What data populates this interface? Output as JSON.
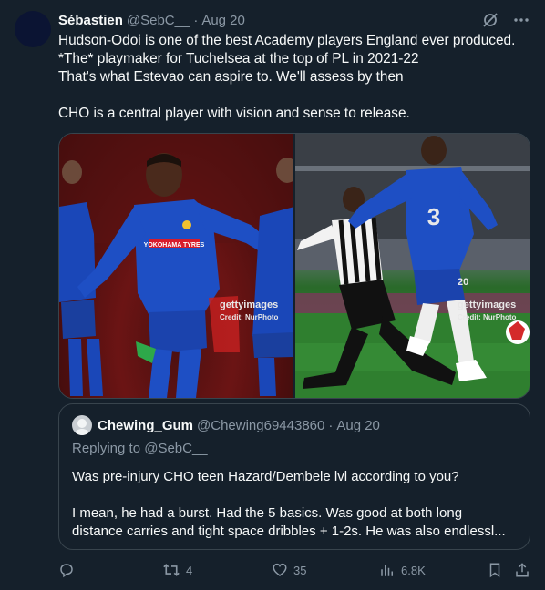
{
  "tweet": {
    "author_name": "Sébastien",
    "author_handle": "@SebC__",
    "separator": "·",
    "date": "Aug 20",
    "lines": [
      "Hudson-Odoi is one of the best Academy players England ever produced.",
      "*The* playmaker for Tuchelsea at the top of PL in 2021-22",
      "That's what Estevao can aspire to. We'll assess by then",
      "",
      "CHO is a central player with vision and sense to release."
    ]
  },
  "media": {
    "watermark_left": "gettyimages",
    "credit_left": "Credit: NurPhoto",
    "watermark_right": "gettyimages",
    "credit_right": "Credit: NurPhoto",
    "shirt_sponsor": "YOKOHAMA TYRES",
    "shirt_number": "3",
    "sleeve_number": "20"
  },
  "quote": {
    "author_name": "Chewing_Gum",
    "author_handle": "@Chewing69443860",
    "separator": "·",
    "date": "Aug 20",
    "replying_to": "Replying to @SebC__",
    "lines": [
      "Was pre-injury CHO teen Hazard/Dembele lvl according to you?",
      "",
      "I mean, he had a burst. Had the 5 basics. Was good at both long",
      "distance carries and tight space dribbles + 1-2s. He was also endlessl..."
    ]
  },
  "actions": {
    "reply_count": "",
    "retweet_count": "4",
    "like_count": "35",
    "view_count": "6.8K"
  },
  "icons": {
    "grok": "grok-icon",
    "more": "more-icon",
    "reply": "reply-icon",
    "retweet": "retweet-icon",
    "like": "like-icon",
    "views": "views-icon",
    "bookmark": "bookmark-icon",
    "share": "share-icon"
  },
  "colors": {
    "background": "#15202b",
    "text_primary": "#f7f9f9",
    "text_secondary": "#8b98a5",
    "border": "#38444d"
  }
}
